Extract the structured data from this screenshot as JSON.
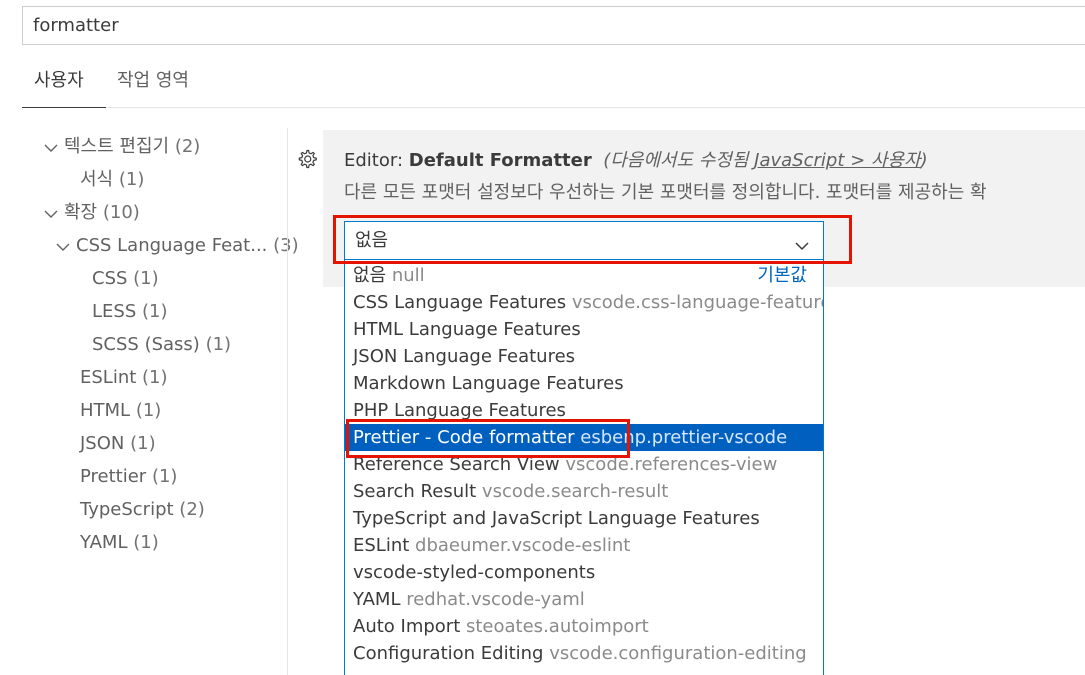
{
  "search": {
    "value": "formatter"
  },
  "tabs": [
    {
      "label": "사용자"
    },
    {
      "label": "작업 영역"
    }
  ],
  "toc": [
    {
      "label": "텍스트 편집기",
      "count": "(2)"
    },
    {
      "label": "서식",
      "count": "(1)"
    },
    {
      "label": "확장",
      "count": "(10)"
    },
    {
      "label": "CSS Language Feat...",
      "count": "(3)"
    },
    {
      "label": "CSS",
      "count": "(1)"
    },
    {
      "label": "LESS",
      "count": "(1)"
    },
    {
      "label": "SCSS (Sass)",
      "count": "(1)"
    },
    {
      "label": "ESLint",
      "count": "(1)"
    },
    {
      "label": "HTML",
      "count": "(1)"
    },
    {
      "label": "JSON",
      "count": "(1)"
    },
    {
      "label": "Prettier",
      "count": "(1)"
    },
    {
      "label": "TypeScript",
      "count": "(2)"
    },
    {
      "label": "YAML",
      "count": "(1)"
    }
  ],
  "setting": {
    "category": "Editor: ",
    "name": "Default Formatter",
    "modified_prefix": "(다음에서도 수정됨 ",
    "modified_link": "JavaScript > 사용자",
    "modified_suffix": ")",
    "description": "다른 모든 포맷터 설정보다 우선하는 기본 포맷터를 정의합니다. 포맷터를 제공하는 확",
    "value": "없음"
  },
  "options": [
    {
      "label": "없음",
      "id": "null",
      "default_label": "기본값"
    },
    {
      "label": "CSS Language Features",
      "id": "vscode.css-language-features"
    },
    {
      "label": "HTML Language Features",
      "id": ""
    },
    {
      "label": "JSON Language Features",
      "id": ""
    },
    {
      "label": "Markdown Language Features",
      "id": ""
    },
    {
      "label": "PHP Language Features",
      "id": ""
    },
    {
      "label": "Prettier - Code formatter",
      "id": "esbenp.prettier-vscode"
    },
    {
      "label": "Reference Search View",
      "id": "vscode.references-view"
    },
    {
      "label": "Search Result",
      "id": "vscode.search-result"
    },
    {
      "label": "TypeScript and JavaScript Language Features",
      "id": ""
    },
    {
      "label": "ESLint",
      "id": "dbaeumer.vscode-eslint"
    },
    {
      "label": "vscode-styled-components",
      "id": ""
    },
    {
      "label": "YAML",
      "id": "redhat.vscode-yaml"
    },
    {
      "label": "Auto Import",
      "id": "steoates.autoimport"
    },
    {
      "label": "Configuration Editing",
      "id": "vscode.configuration-editing"
    }
  ],
  "colors": {
    "accent": "#007acc",
    "selection": "#0060c0",
    "highlight": "#e51400"
  }
}
